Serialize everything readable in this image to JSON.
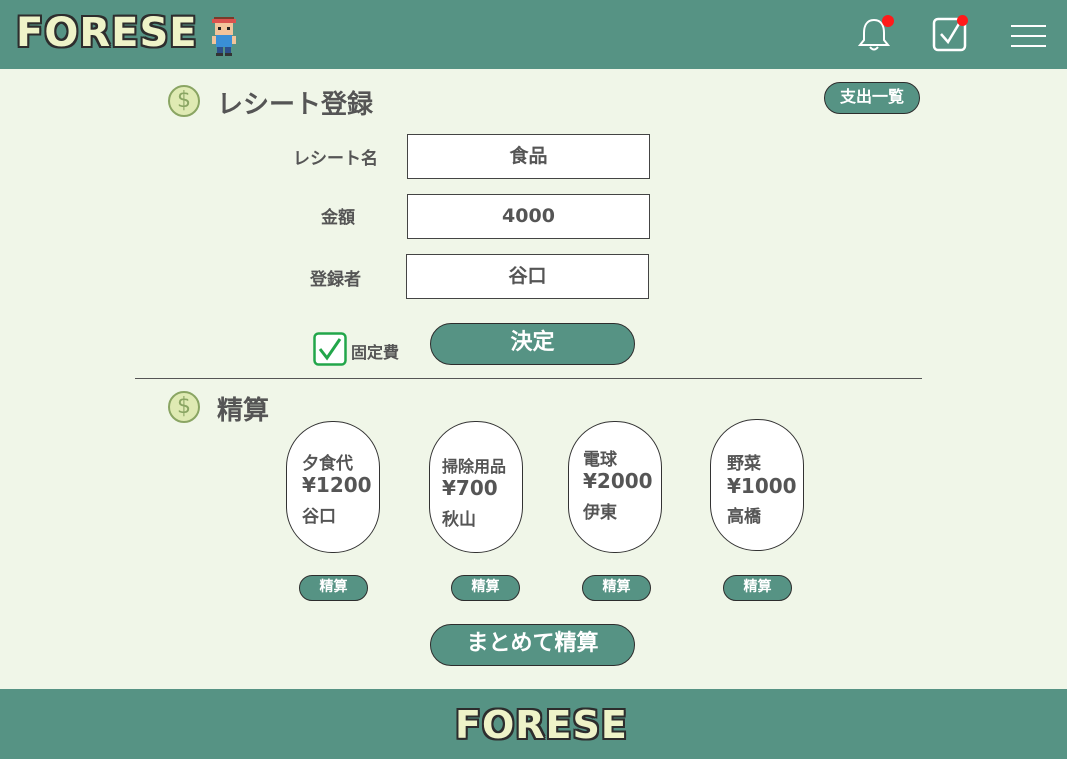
{
  "header": {
    "logo": "FORESE",
    "notification_badge_color": "#ff1a1a",
    "icons": [
      "mascot-icon",
      "bell-icon",
      "checkbox-icon",
      "menu-icon"
    ]
  },
  "receipt_section": {
    "title": "レシート登録",
    "expense_list_button": "支出一覧",
    "fields": {
      "name": {
        "label": "レシート名",
        "value": "食品"
      },
      "amount": {
        "label": "金額",
        "value": "4000"
      },
      "registrant": {
        "label": "登録者",
        "value": "谷口"
      }
    },
    "fixed_cost": {
      "label": "固定費",
      "checked": true
    },
    "submit_button": "決定"
  },
  "settlement_section": {
    "title": "精算",
    "cards": [
      {
        "name": "夕食代",
        "amount": "¥1200",
        "person": "谷口",
        "button": "精算"
      },
      {
        "name": "掃除用品",
        "amount": "¥700",
        "person": "秋山",
        "button": "精算"
      },
      {
        "name": "電球",
        "amount": "¥2000",
        "person": "伊東",
        "button": "精算"
      },
      {
        "name": "野菜",
        "amount": "¥1000",
        "person": "高橋",
        "button": "精算"
      }
    ],
    "settle_all_button": "まとめて精算"
  },
  "footer": {
    "logo": "FORESE"
  },
  "colors": {
    "brand": "#569384",
    "background": "#f0f6e8",
    "logo_fill": "#eef3c8",
    "checkbox_accent": "#22a64a"
  }
}
